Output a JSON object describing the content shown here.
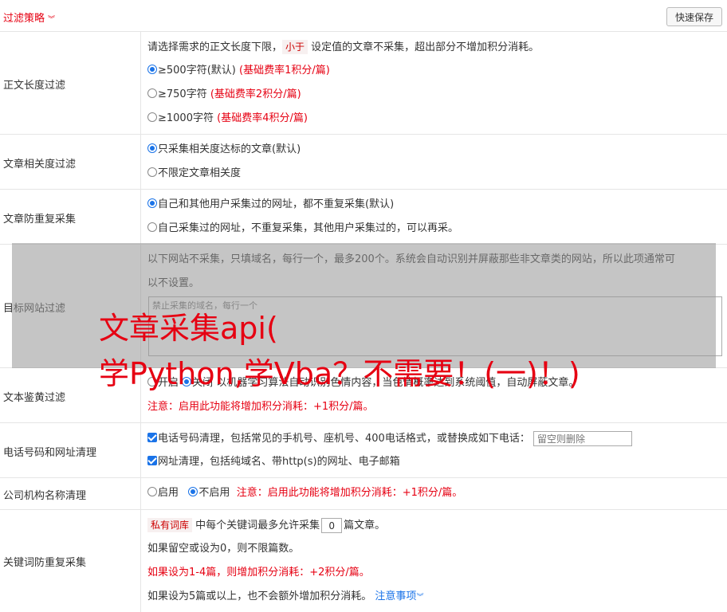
{
  "header": {
    "title": "过滤策略",
    "save_label": "快速保存"
  },
  "length_filter": {
    "label": "正文长度过滤",
    "desc_pre": "请选择需求的正文长度下限，",
    "desc_tag": "小于",
    "desc_post": "设定值的文章不采集，超出部分不增加积分消耗。",
    "options": [
      {
        "label": "≥500字符(默认)",
        "note": "(基础费率1积分/篇)",
        "selected": true
      },
      {
        "label": "≥750字符",
        "note": "(基础费率2积分/篇)",
        "selected": false
      },
      {
        "label": "≥1000字符",
        "note": "(基础费率4积分/篇)",
        "selected": false
      }
    ]
  },
  "relevance_filter": {
    "label": "文章相关度过滤",
    "options": [
      {
        "label": "只采集相关度达标的文章(默认)",
        "selected": true
      },
      {
        "label": "不限定文章相关度",
        "selected": false
      }
    ]
  },
  "dup_filter": {
    "label": "文章防重复采集",
    "options": [
      {
        "label": "自己和其他用户采集过的网址，都不重复采集(默认)",
        "selected": true
      },
      {
        "label": "自己采集过的网址，不重复采集，其他用户采集过的，可以再采。",
        "selected": false
      }
    ]
  },
  "site_filter": {
    "label": "目标网站过滤",
    "desc1": "以下网站不采集，只填域名，每行一个，最多200个。系统会自动识别并屏蔽那些非文章类的网站，所以此项通常可",
    "desc2": "以不设置。",
    "placeholder": "禁止采集的域名，每行一个"
  },
  "porn_filter": {
    "label": "文本鉴黄过滤",
    "opt_on": "开启",
    "opt_off": "关闭",
    "desc": "以机器学习算法自动识别色情内容，当色情概率达到系统阈值，自动屏蔽文章。",
    "note": "注意：启用此功能将增加积分消耗：+1积分/篇。"
  },
  "phone_filter": {
    "label": "电话号码和网址清理",
    "opt1": "电话号码清理，包括常见的手机号、座机号、400电话格式，或替换成如下电话：",
    "opt1_placeholder": "留空则删除",
    "opt2": "网址清理，包括纯域名、带http(s)的网址、电子邮箱"
  },
  "company_filter": {
    "label": "公司机构名称清理",
    "opt_on": "启用",
    "opt_off": "不启用",
    "note": "注意：启用此功能将增加积分消耗：+1积分/篇。"
  },
  "keyword_filter": {
    "label": "关键词防重复采集",
    "tag": "私有词库",
    "line1_mid": "中每个关键词最多允许采集",
    "value": "0",
    "line1_post": "篇文章。",
    "line2": "如果留空或设为0，则不限篇数。",
    "line3": "如果设为1-4篇，则增加积分消耗：+2积分/篇。",
    "line4": "如果设为5篇或以上，也不会额外增加积分消耗。",
    "link": "注意事项"
  },
  "watermark": {
    "line1": "文章采集api(",
    "line2": "学Python,学Vba？不需要！(一)！)"
  },
  "colors": {
    "accent": "#e60012",
    "link": "#1a73e8",
    "border": "#e5e5e5"
  }
}
